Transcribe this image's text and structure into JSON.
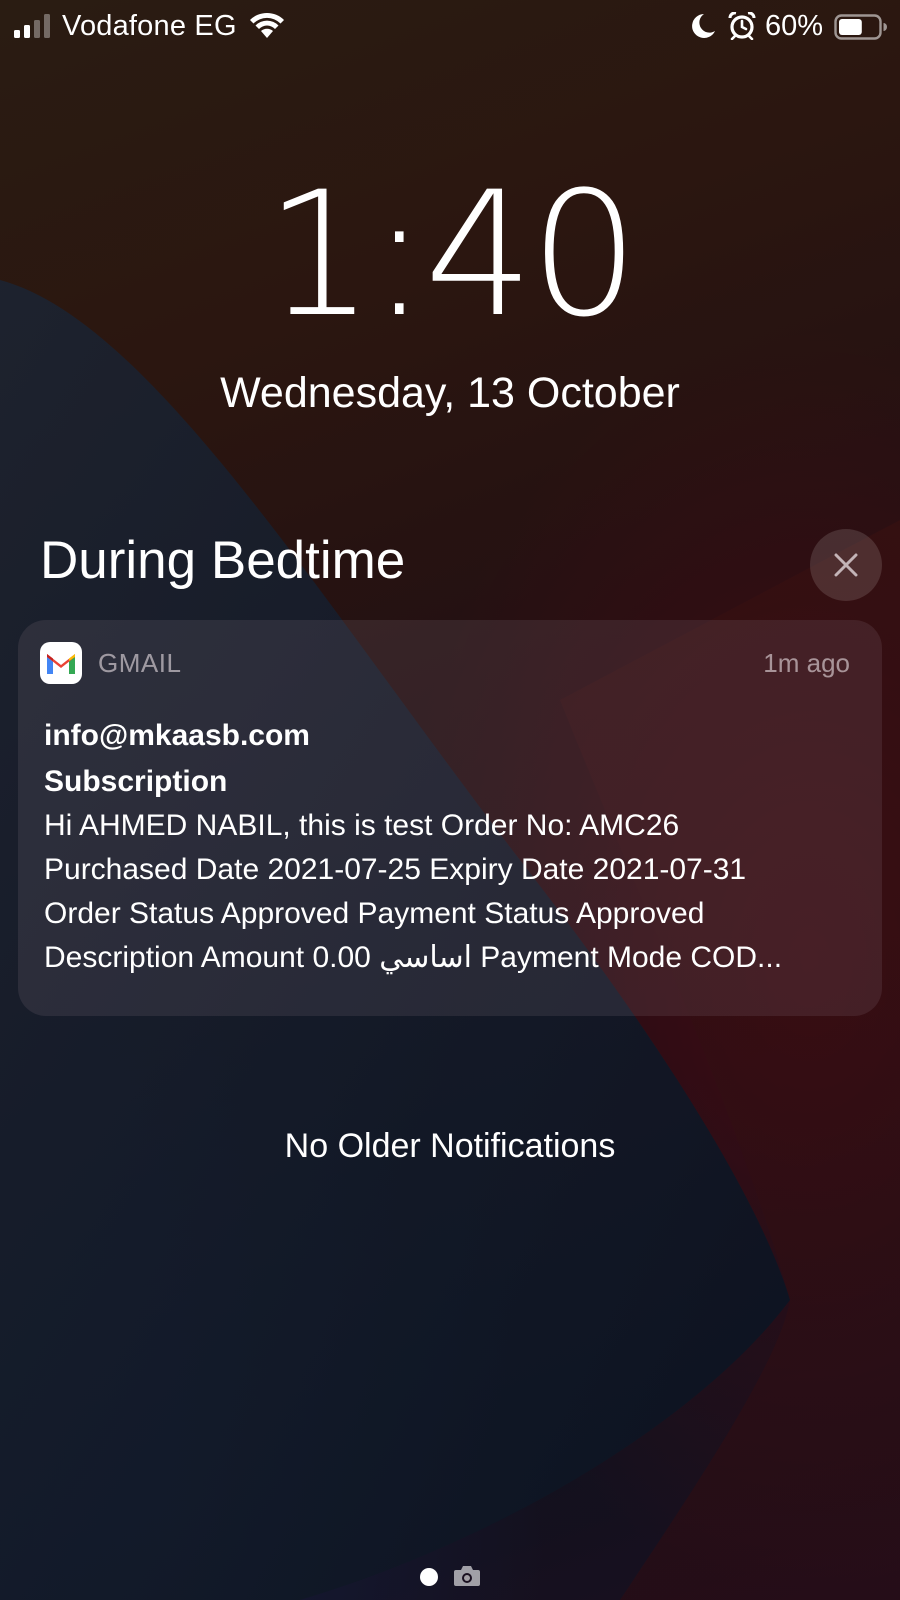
{
  "status_bar": {
    "carrier": "Vodafone EG",
    "battery_percent": "60%",
    "battery_level": 0.6,
    "signal_bars": 2,
    "icons": [
      "signal-icon",
      "wifi-icon",
      "moon-icon",
      "alarm-clock-icon",
      "battery-icon"
    ]
  },
  "lock_screen": {
    "time": "1:40",
    "date": "Wednesday, 13 October"
  },
  "focus": {
    "title": "During Bedtime",
    "close_icon": "close-icon"
  },
  "notification": {
    "app_icon": "gmail-icon",
    "app_name": "GMAIL",
    "time": "1m ago",
    "sender": "info@mkaasb.com",
    "subject": "Subscription",
    "body_lines": [
      "Hi AHMED NABIL, this is test Order No: AMC26",
      "Purchased Date 2021-07-25 Expiry Date 2021-07-31",
      "Order Status Approved Payment Status Approved",
      "Description Amount 0.00 اساسي Payment Mode COD..."
    ]
  },
  "footer": {
    "no_older": "No Older Notifications",
    "page_indicator_icon": "camera-icon"
  },
  "colors": {
    "text": "#ffffff",
    "muted_text": "#b4aab0",
    "gmail_red": "#ea4335",
    "gmail_blue": "#4285f4",
    "gmail_green": "#34a853",
    "gmail_yellow": "#fbbc04"
  }
}
